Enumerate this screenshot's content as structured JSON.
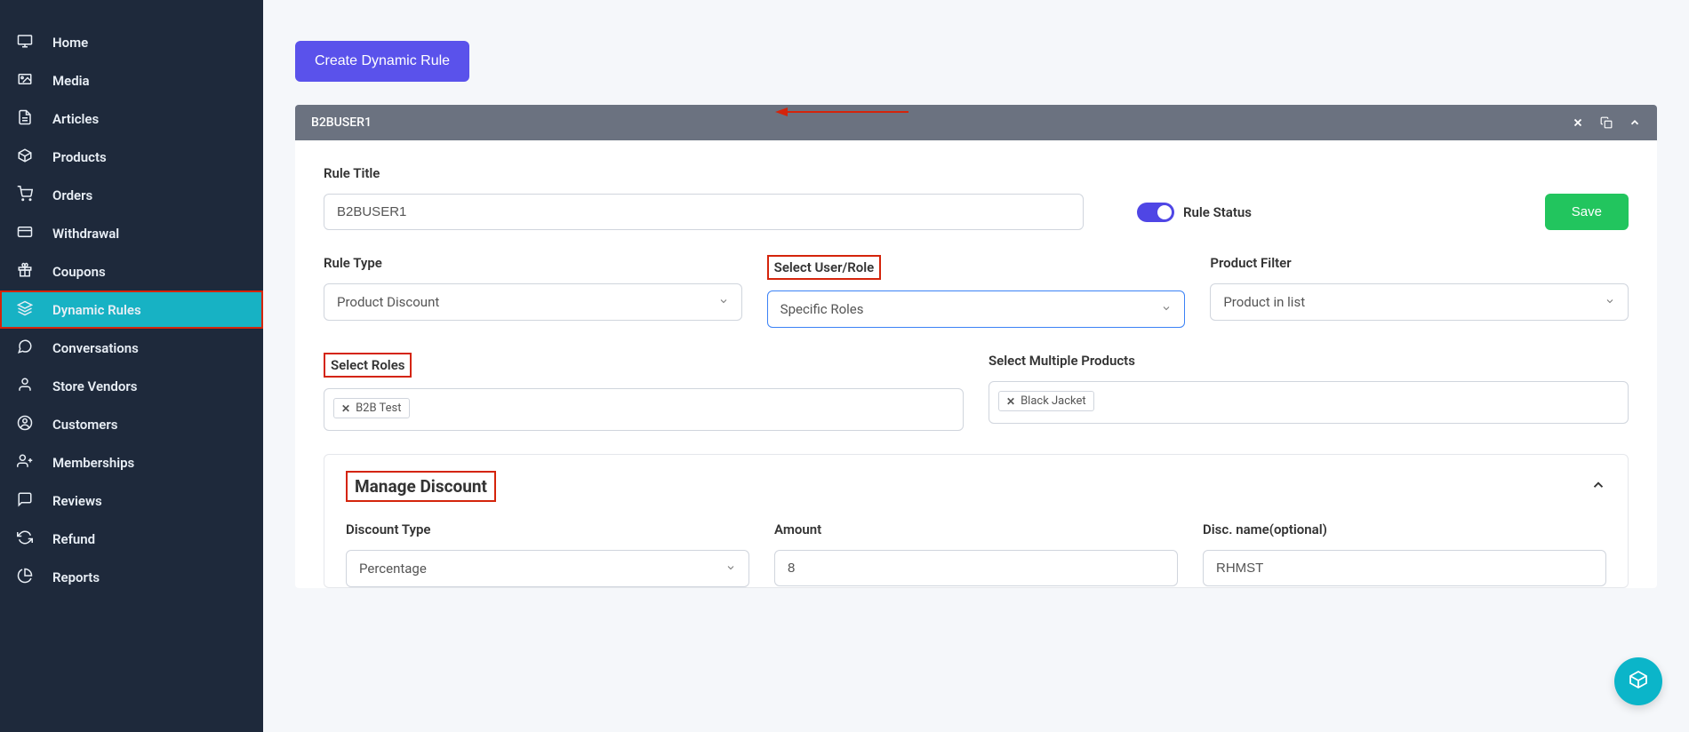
{
  "sidebar": {
    "items": [
      {
        "label": "Home"
      },
      {
        "label": "Media"
      },
      {
        "label": "Articles"
      },
      {
        "label": "Products"
      },
      {
        "label": "Orders"
      },
      {
        "label": "Withdrawal"
      },
      {
        "label": "Coupons"
      },
      {
        "label": "Dynamic Rules"
      },
      {
        "label": "Conversations"
      },
      {
        "label": "Store Vendors"
      },
      {
        "label": "Customers"
      },
      {
        "label": "Memberships"
      },
      {
        "label": "Reviews"
      },
      {
        "label": "Refund"
      },
      {
        "label": "Reports"
      }
    ],
    "active_index": 7
  },
  "create_button_label": "Create Dynamic Rule",
  "panel": {
    "title": "B2BUSER1",
    "rule_title_label": "Rule Title",
    "rule_title_value": "B2BUSER1",
    "rule_status_label": "Rule Status",
    "rule_status_on": true,
    "save_label": "Save",
    "rule_type_label": "Rule Type",
    "rule_type_value": "Product Discount",
    "select_user_role_label": "Select User/Role",
    "select_user_role_value": "Specific Roles",
    "product_filter_label": "Product Filter",
    "product_filter_value": "Product in list",
    "select_roles_label": "Select Roles",
    "select_roles_tags": [
      "B2B Test"
    ],
    "select_products_label": "Select Multiple Products",
    "select_products_tags": [
      "Black Jacket"
    ],
    "manage_discount_label": "Manage Discount",
    "discount_type_label": "Discount Type",
    "discount_type_value": "Percentage",
    "amount_label": "Amount",
    "amount_value": "8",
    "disc_name_label": "Disc. name(optional)",
    "disc_name_value": "RHMST"
  }
}
